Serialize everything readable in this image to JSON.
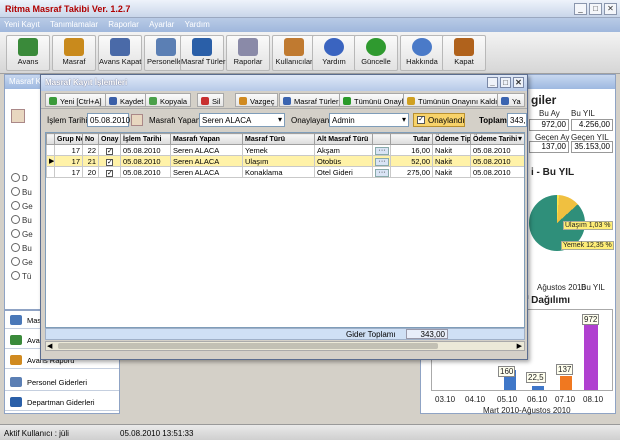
{
  "app": {
    "title": "Ritma Masraf Takibi Ver. 1.2.7",
    "window_buttons": [
      "_",
      "□",
      "✕"
    ]
  },
  "menu": [
    "Yeni Kayıt",
    "Tanımlamalar",
    "Raporlar",
    "Ayarlar",
    "Yardım"
  ],
  "toolbar": [
    {
      "label": "Avans",
      "icon": "avans-icon",
      "color": "#3a8a3a"
    },
    {
      "label": "Masraf",
      "icon": "masraf-icon",
      "color": "#c98a1c"
    },
    {
      "label": "Avans Kapat",
      "icon": "avans-kapat-icon",
      "color": "#4a6aa8"
    },
    {
      "label": "Personeller",
      "icon": "personel-icon",
      "color": "#5b7fb4"
    },
    {
      "label": "Masraf Türleri",
      "icon": "masraf-turleri-icon",
      "color": "#2a5fa8"
    },
    {
      "label": "Raporlar",
      "icon": "raporlar-icon",
      "color": "#8a8aa8"
    },
    {
      "label": "Kullanıcılar",
      "icon": "kullanicilar-icon",
      "color": "#c07a30"
    },
    {
      "label": "Yardım",
      "icon": "yardim-icon",
      "color": "#3a64c0"
    },
    {
      "label": "Güncelle",
      "icon": "guncelle-icon",
      "color": "#2f9a2f"
    },
    {
      "label": "Hakkında",
      "icon": "hakkinda-icon",
      "color": "#4a7ac8"
    },
    {
      "label": "Kapat",
      "icon": "kapat-icon",
      "color": "#b0621c"
    }
  ],
  "background": {
    "left_header": "Masraf K",
    "radio_labels": [
      "D",
      "Bu",
      "Ge",
      "Bu",
      "Ge",
      "Bu",
      "Ge",
      "Tü"
    ],
    "right_title": "giler",
    "right_rows": [
      {
        "label": "Bu Ay",
        "val": "972,00",
        "label2": "Bu YIL",
        "val2": "4.256,00"
      },
      {
        "label": "Geçen Ay",
        "val": "137,00",
        "label2": "Geçen YIL",
        "val2": "35.153,00"
      }
    ],
    "pie_title": "i - Bu YIL",
    "pie_labels": [
      "Ulaşım 1,03 %",
      "Yemek 12,35 %"
    ],
    "pie_tabs": [
      "Ağustos 2010",
      "Bu YIL"
    ],
    "bar_title": "f Dağılımı",
    "bar_x": [
      "03.10",
      "04.10",
      "05.10",
      "06.10",
      "07.10",
      "08.10"
    ],
    "bar_values": [
      "160",
      "22,5",
      "137",
      "972"
    ],
    "bar_range": "Mart 2010-Ağustos 2010"
  },
  "nav": [
    {
      "label": "Masraf"
    },
    {
      "label": "Avans"
    },
    {
      "label": "Avans Raporu"
    },
    {
      "label": "Personel Giderleri"
    },
    {
      "label": "Departman Giderleri"
    }
  ],
  "dialog": {
    "title": "Masraf Kayıt İşlemleri",
    "buttons": [
      {
        "label": "Yeni [Ctrl+A]",
        "color": "#3a9a3a"
      },
      {
        "label": "Kaydet",
        "color": "#3a5fa8"
      },
      {
        "label": "Kopyala",
        "color": "#4aa04a"
      },
      {
        "label": "Sil",
        "color": "#c83030"
      },
      {
        "label": "Vazgeç",
        "color": "#d08a20"
      },
      {
        "label": "Masraf Türleri",
        "color": "#3a64b0"
      },
      {
        "label": "Tümünü Onayla",
        "color": "#2a9a2a"
      },
      {
        "label": "Tümünün Onayını Kaldır",
        "color": "#d0a020"
      },
      {
        "label": "Ya",
        "color": "#3a64b0"
      }
    ],
    "filter": {
      "date_label": "İşlem Tarihi",
      "date": "05.08.2010",
      "spender_label": "Masrafı Yapan",
      "spender": "Seren ALACA",
      "approver_label": "Onaylayan",
      "approver": "Admin",
      "approved_label": "Onaylandı",
      "total_label": "Toplam",
      "total": "343,"
    },
    "columns": [
      "Grup No",
      "No",
      "Onay",
      "İşlem Tarihi",
      "Masrafı Yapan",
      "Masraf Türü",
      "Alt Masraf Türü",
      "",
      "Tutar",
      "Ödeme Tipi",
      "Ödeme Tarihi"
    ],
    "rows": [
      {
        "grup": "17",
        "no": "22",
        "onay": "✓",
        "tarih": "05.08.2010",
        "yapan": "Seren ALACA",
        "tur": "Yemek",
        "alt": "Akşam",
        "tutar": "16,00",
        "odeme": "Nakit",
        "odeme_tarih": "05.08.2010"
      },
      {
        "grup": "17",
        "no": "21",
        "onay": "✓",
        "tarih": "05.08.2010",
        "yapan": "Seren ALACA",
        "tur": "Ulaşım",
        "alt": "Otobüs",
        "tutar": "52,00",
        "odeme": "Nakit",
        "odeme_tarih": "05.08.2010"
      },
      {
        "grup": "17",
        "no": "20",
        "onay": "✓",
        "tarih": "05.08.2010",
        "yapan": "Seren ALACA",
        "tur": "Konaklama",
        "alt": "Otel Gideri",
        "tutar": "275,00",
        "odeme": "Nakit",
        "odeme_tarih": "05.08.2010"
      }
    ],
    "footer_label": "Gider Toplamı",
    "footer_total": "343,00"
  },
  "status": {
    "user": "Aktif Kullanıcı : jüli",
    "datetime": "05.08.2010 13:51:33"
  }
}
